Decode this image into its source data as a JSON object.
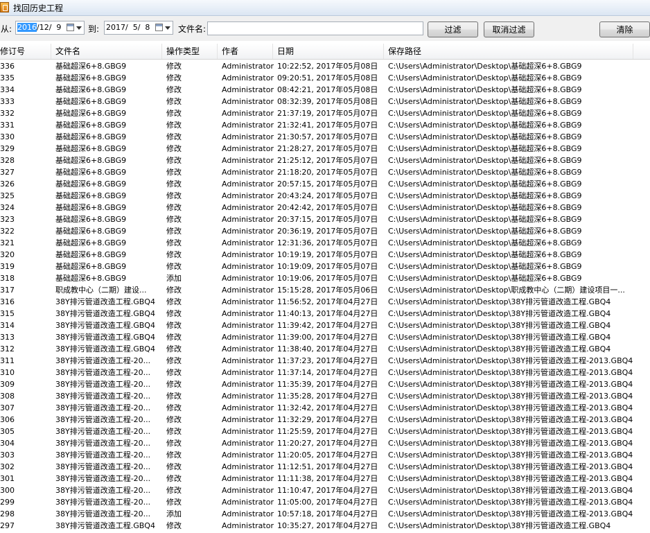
{
  "window": {
    "title": "找回历史工程"
  },
  "filter": {
    "from_label": "从:",
    "from_selected": "2016",
    "from_rest": "/12/  9",
    "to_label": "到:",
    "to_value": "2017/  5/  8",
    "filename_label": "文件名:",
    "filename_value": "",
    "filter_button": "过滤",
    "cancel_filter_button": "取消过滤",
    "clear_button": "清除"
  },
  "table": {
    "columns": [
      "修订号",
      "文件名",
      "操作类型",
      "作者",
      "日期",
      "保存路径"
    ],
    "rows": [
      [
        "336",
        "基础超深6+8.GBG9",
        "修改",
        "Administrator",
        "10:22:52, 2017年05月08日",
        "C:\\Users\\Administrator\\Desktop\\基础超深6+8.GBG9"
      ],
      [
        "335",
        "基础超深6+8.GBG9",
        "修改",
        "Administrator",
        "09:20:51, 2017年05月08日",
        "C:\\Users\\Administrator\\Desktop\\基础超深6+8.GBG9"
      ],
      [
        "334",
        "基础超深6+8.GBG9",
        "修改",
        "Administrator",
        "08:42:21, 2017年05月08日",
        "C:\\Users\\Administrator\\Desktop\\基础超深6+8.GBG9"
      ],
      [
        "333",
        "基础超深6+8.GBG9",
        "修改",
        "Administrator",
        "08:32:39, 2017年05月08日",
        "C:\\Users\\Administrator\\Desktop\\基础超深6+8.GBG9"
      ],
      [
        "332",
        "基础超深6+8.GBG9",
        "修改",
        "Administrator",
        "21:37:19, 2017年05月07日",
        "C:\\Users\\Administrator\\Desktop\\基础超深6+8.GBG9"
      ],
      [
        "331",
        "基础超深6+8.GBG9",
        "修改",
        "Administrator",
        "21:32:41, 2017年05月07日",
        "C:\\Users\\Administrator\\Desktop\\基础超深6+8.GBG9"
      ],
      [
        "330",
        "基础超深6+8.GBG9",
        "修改",
        "Administrator",
        "21:30:57, 2017年05月07日",
        "C:\\Users\\Administrator\\Desktop\\基础超深6+8.GBG9"
      ],
      [
        "329",
        "基础超深6+8.GBG9",
        "修改",
        "Administrator",
        "21:28:27, 2017年05月07日",
        "C:\\Users\\Administrator\\Desktop\\基础超深6+8.GBG9"
      ],
      [
        "328",
        "基础超深6+8.GBG9",
        "修改",
        "Administrator",
        "21:25:12, 2017年05月07日",
        "C:\\Users\\Administrator\\Desktop\\基础超深6+8.GBG9"
      ],
      [
        "327",
        "基础超深6+8.GBG9",
        "修改",
        "Administrator",
        "21:18:20, 2017年05月07日",
        "C:\\Users\\Administrator\\Desktop\\基础超深6+8.GBG9"
      ],
      [
        "326",
        "基础超深6+8.GBG9",
        "修改",
        "Administrator",
        "20:57:15, 2017年05月07日",
        "C:\\Users\\Administrator\\Desktop\\基础超深6+8.GBG9"
      ],
      [
        "325",
        "基础超深6+8.GBG9",
        "修改",
        "Administrator",
        "20:43:24, 2017年05月07日",
        "C:\\Users\\Administrator\\Desktop\\基础超深6+8.GBG9"
      ],
      [
        "324",
        "基础超深6+8.GBG9",
        "修改",
        "Administrator",
        "20:42:42, 2017年05月07日",
        "C:\\Users\\Administrator\\Desktop\\基础超深6+8.GBG9"
      ],
      [
        "323",
        "基础超深6+8.GBG9",
        "修改",
        "Administrator",
        "20:37:15, 2017年05月07日",
        "C:\\Users\\Administrator\\Desktop\\基础超深6+8.GBG9"
      ],
      [
        "322",
        "基础超深6+8.GBG9",
        "修改",
        "Administrator",
        "20:36:19, 2017年05月07日",
        "C:\\Users\\Administrator\\Desktop\\基础超深6+8.GBG9"
      ],
      [
        "321",
        "基础超深6+8.GBG9",
        "修改",
        "Administrator",
        "12:31:36, 2017年05月07日",
        "C:\\Users\\Administrator\\Desktop\\基础超深6+8.GBG9"
      ],
      [
        "320",
        "基础超深6+8.GBG9",
        "修改",
        "Administrator",
        "10:19:19, 2017年05月07日",
        "C:\\Users\\Administrator\\Desktop\\基础超深6+8.GBG9"
      ],
      [
        "319",
        "基础超深6+8.GBG9",
        "修改",
        "Administrator",
        "10:19:09, 2017年05月07日",
        "C:\\Users\\Administrator\\Desktop\\基础超深6+8.GBG9"
      ],
      [
        "318",
        "基础超深6+8.GBG9",
        "添加",
        "Administrator",
        "10:19:06, 2017年05月07日",
        "C:\\Users\\Administrator\\Desktop\\基础超深6+8.GBG9"
      ],
      [
        "317",
        "职成教中心（二期）建设...",
        "修改",
        "Administrator",
        "15:15:28, 2017年05月06日",
        "C:\\Users\\Administrator\\Desktop\\职成教中心（二期）建设项目一..."
      ],
      [
        "316",
        "38Y排污管道改造工程.GBQ4",
        "修改",
        "Administrator",
        "11:56:52, 2017年04月27日",
        "C:\\Users\\Administrator\\Desktop\\38Y排污管道改造工程.GBQ4"
      ],
      [
        "315",
        "38Y排污管道改造工程.GBQ4",
        "修改",
        "Administrator",
        "11:40:13, 2017年04月27日",
        "C:\\Users\\Administrator\\Desktop\\38Y排污管道改造工程.GBQ4"
      ],
      [
        "314",
        "38Y排污管道改造工程.GBQ4",
        "修改",
        "Administrator",
        "11:39:42, 2017年04月27日",
        "C:\\Users\\Administrator\\Desktop\\38Y排污管道改造工程.GBQ4"
      ],
      [
        "313",
        "38Y排污管道改造工程.GBQ4",
        "修改",
        "Administrator",
        "11:39:00, 2017年04月27日",
        "C:\\Users\\Administrator\\Desktop\\38Y排污管道改造工程.GBQ4"
      ],
      [
        "312",
        "38Y排污管道改造工程.GBQ4",
        "修改",
        "Administrator",
        "11:38:40, 2017年04月27日",
        "C:\\Users\\Administrator\\Desktop\\38Y排污管道改造工程.GBQ4"
      ],
      [
        "311",
        "38Y排污管道改造工程-20...",
        "修改",
        "Administrator",
        "11:37:23, 2017年04月27日",
        "C:\\Users\\Administrator\\Desktop\\38Y排污管道改造工程-2013.GBQ4"
      ],
      [
        "310",
        "38Y排污管道改造工程-20...",
        "修改",
        "Administrator",
        "11:37:14, 2017年04月27日",
        "C:\\Users\\Administrator\\Desktop\\38Y排污管道改造工程-2013.GBQ4"
      ],
      [
        "309",
        "38Y排污管道改造工程-20...",
        "修改",
        "Administrator",
        "11:35:39, 2017年04月27日",
        "C:\\Users\\Administrator\\Desktop\\38Y排污管道改造工程-2013.GBQ4"
      ],
      [
        "308",
        "38Y排污管道改造工程-20...",
        "修改",
        "Administrator",
        "11:35:28, 2017年04月27日",
        "C:\\Users\\Administrator\\Desktop\\38Y排污管道改造工程-2013.GBQ4"
      ],
      [
        "307",
        "38Y排污管道改造工程-20...",
        "修改",
        "Administrator",
        "11:32:42, 2017年04月27日",
        "C:\\Users\\Administrator\\Desktop\\38Y排污管道改造工程-2013.GBQ4"
      ],
      [
        "306",
        "38Y排污管道改造工程-20...",
        "修改",
        "Administrator",
        "11:32:29, 2017年04月27日",
        "C:\\Users\\Administrator\\Desktop\\38Y排污管道改造工程-2013.GBQ4"
      ],
      [
        "305",
        "38Y排污管道改造工程-20...",
        "修改",
        "Administrator",
        "11:25:59, 2017年04月27日",
        "C:\\Users\\Administrator\\Desktop\\38Y排污管道改造工程-2013.GBQ4"
      ],
      [
        "304",
        "38Y排污管道改造工程-20...",
        "修改",
        "Administrator",
        "11:20:27, 2017年04月27日",
        "C:\\Users\\Administrator\\Desktop\\38Y排污管道改造工程-2013.GBQ4"
      ],
      [
        "303",
        "38Y排污管道改造工程-20...",
        "修改",
        "Administrator",
        "11:20:05, 2017年04月27日",
        "C:\\Users\\Administrator\\Desktop\\38Y排污管道改造工程-2013.GBQ4"
      ],
      [
        "302",
        "38Y排污管道改造工程-20...",
        "修改",
        "Administrator",
        "11:12:51, 2017年04月27日",
        "C:\\Users\\Administrator\\Desktop\\38Y排污管道改造工程-2013.GBQ4"
      ],
      [
        "301",
        "38Y排污管道改造工程-20...",
        "修改",
        "Administrator",
        "11:11:38, 2017年04月27日",
        "C:\\Users\\Administrator\\Desktop\\38Y排污管道改造工程-2013.GBQ4"
      ],
      [
        "300",
        "38Y排污管道改造工程-20...",
        "修改",
        "Administrator",
        "11:10:47, 2017年04月27日",
        "C:\\Users\\Administrator\\Desktop\\38Y排污管道改造工程-2013.GBQ4"
      ],
      [
        "299",
        "38Y排污管道改造工程-20...",
        "修改",
        "Administrator",
        "11:05:00, 2017年04月27日",
        "C:\\Users\\Administrator\\Desktop\\38Y排污管道改造工程-2013.GBQ4"
      ],
      [
        "298",
        "38Y排污管道改造工程-20...",
        "添加",
        "Administrator",
        "10:57:18, 2017年04月27日",
        "C:\\Users\\Administrator\\Desktop\\38Y排污管道改造工程-2013.GBQ4"
      ],
      [
        "297",
        "38Y排污管道改造工程.GBQ4",
        "修改",
        "Administrator",
        "10:35:27, 2017年04月27日",
        "C:\\Users\\Administrator\\Desktop\\38Y排污管道改造工程.GBQ4"
      ]
    ]
  }
}
